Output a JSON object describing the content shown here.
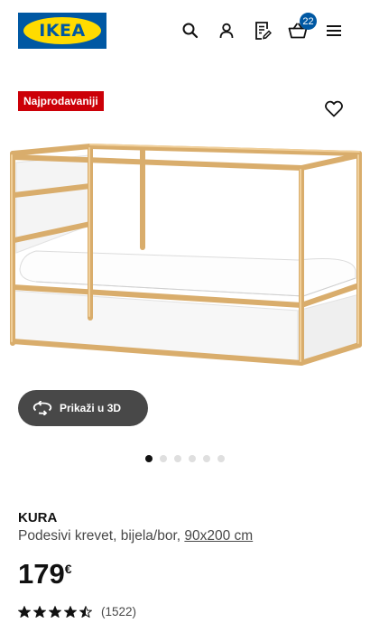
{
  "header": {
    "logo_text": "IKEA",
    "cart_count": "22",
    "icons": [
      "search-icon",
      "user-icon",
      "shopping-list-icon",
      "cart-icon",
      "menu-icon"
    ]
  },
  "product": {
    "badge": "Najprodavaniji",
    "name": "KURA",
    "description": "Podesivi krevet, bijela/bor, ",
    "size": "90x200 cm",
    "price": "179",
    "currency": "€",
    "rating_count": "(1522)",
    "rating_value": 4.5,
    "view_3d_label": "Prikaži u 3D"
  },
  "gallery": {
    "total": 6,
    "active": 0
  },
  "colors": {
    "ikea_blue": "#0058a3",
    "ikea_yellow": "#ffdb00",
    "badge_red": "#cc0008",
    "dark_button": "#484848"
  }
}
